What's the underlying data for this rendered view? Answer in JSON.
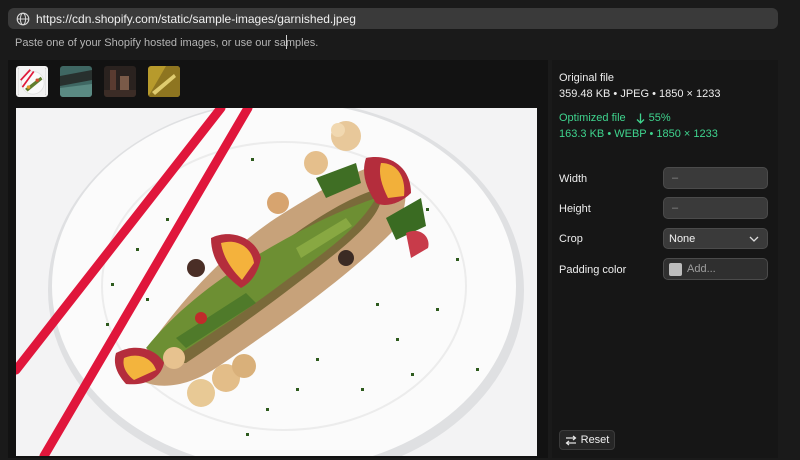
{
  "url_bar": {
    "value": "https://cdn.shopify.com/static/sample-images/garnished.jpeg",
    "icon": "globe-icon"
  },
  "hint_text": "Paste one of your Shopify hosted images, or use our samples.",
  "thumbnails": [
    {
      "name": "garnished",
      "selected": true
    },
    {
      "name": "teal-sample",
      "selected": false
    },
    {
      "name": "dark-sample",
      "selected": false
    },
    {
      "name": "gold-sample",
      "selected": false
    }
  ],
  "original": {
    "title": "Original file",
    "details": "359.48 KB • JPEG • 1850 × 1233"
  },
  "optimized": {
    "title": "Optimized file",
    "reduction": "55%",
    "details": "163.3 KB • WEBP • 1850 × 1233",
    "color": "#3fd48e"
  },
  "fields": {
    "width_label": "Width",
    "width_placeholder": "–",
    "height_label": "Height",
    "height_placeholder": "–",
    "crop_label": "Crop",
    "crop_value": "None",
    "padding_label": "Padding color",
    "padding_placeholder": "Add..."
  },
  "reset_label": "Reset"
}
